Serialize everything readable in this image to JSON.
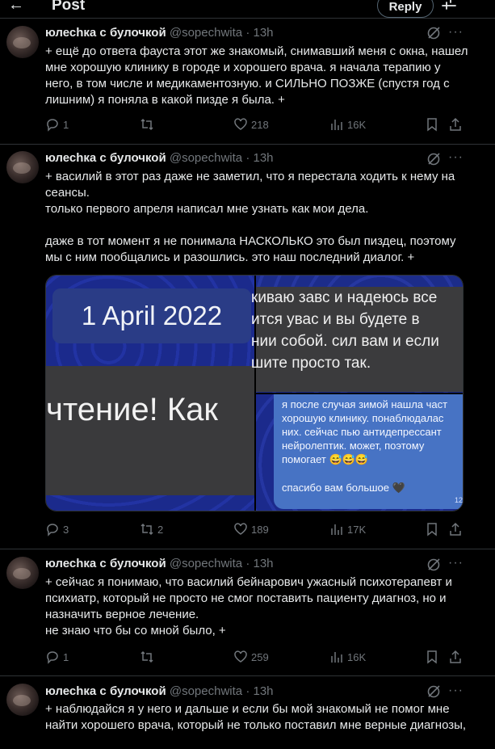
{
  "header": {
    "back": "←",
    "title": "Post",
    "reply_label": "Reply"
  },
  "tweets": [
    {
      "author": "юлесhка с булочкой",
      "handle": "@sopechwita",
      "dot": "·",
      "time": "13h",
      "more": "···",
      "lines": [
        "+ ещё до ответа фауста этот же знакомый, снимавший меня с окна, нашел",
        "мне хорошую клинику в городе и хорошего врача. я начала терапию у",
        "него, в том числе и медикаментозную. и СИЛЬНО ПОЗЖЕ (спустя год с",
        "лишним) я поняла в какой пизде я была. +"
      ],
      "replies": "1",
      "retweets": "",
      "likes": "218",
      "views": "16K"
    },
    {
      "author": "юлесhка с булочкой",
      "handle": "@sopechwita",
      "dot": "·",
      "time": "13h",
      "more": "···",
      "lines": [
        "+ василий в этот раз даже не заметил, что я перестала ходить к нему на",
        "сеансы.",
        "только первого апреля написал мне узнать как мои дела.",
        "",
        "даже в тот момент я не понимала НАСКОЛЬКО это был пиздец, поэтому",
        "мы с ним пообщались и разошлись. это наш последний диалог. +"
      ],
      "media": {
        "date": "1 April 2022",
        "left_message": "чтение! Как",
        "right_top_lines": [
          "киваю завс и надеюсь все",
          "ится увас и вы будете в",
          "нии собой. сил вам и если",
          "шите просто так."
        ],
        "right_bottom_lines": [
          "я после случая зимой нашла част",
          "хорошую клинику. понаблюдалас",
          "них. сейчас пью антидепрессант",
          "нейролептик. может, поэтому",
          "помогает 😅😅😅",
          "",
          "спасибо вам большое 🖤"
        ],
        "right_bottom_time": "12"
      },
      "replies": "3",
      "retweets": "2",
      "likes": "189",
      "views": "17K"
    },
    {
      "author": "юлесhка с булочкой",
      "handle": "@sopechwita",
      "dot": "·",
      "time": "13h",
      "more": "···",
      "lines": [
        "+ сейчас я понимаю, что василий бейнарович ужасный психотерапевт и",
        "психиатр, который не просто не смог поставить пациенту диагноз, но и",
        "назначить верное лечение.",
        "не знаю что бы со мной было, +"
      ],
      "replies": "1",
      "retweets": "",
      "likes": "259",
      "views": "16K"
    },
    {
      "author": "юлесhка с булочкой",
      "handle": "@sopechwita",
      "dot": "·",
      "time": "13h",
      "more": "···",
      "lines": [
        "+ наблюдайся я у него и дальше и если бы мой знакомый не помог мне",
        "найти хорошего врача, который не только поставил мне верные диагнозы,"
      ]
    }
  ],
  "colors": {
    "background": "#000000",
    "text": "#e7e9ea",
    "muted": "#71767b",
    "border": "#2f3336"
  }
}
